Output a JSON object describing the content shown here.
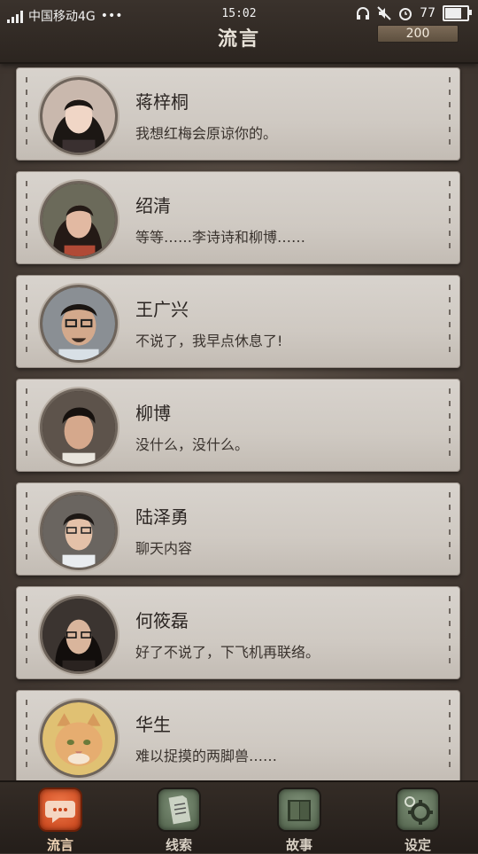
{
  "status_bar": {
    "carrier": "中国移动4G",
    "dots": "•••",
    "time": "15:02",
    "battery_percent": "77",
    "battery_level": 0.77
  },
  "header": {
    "title": "流言",
    "coins": "200"
  },
  "contacts": [
    {
      "name": "蒋梓桐",
      "message": "我想红梅会原谅你的。"
    },
    {
      "name": "绍清",
      "message": "等等……李诗诗和柳博……"
    },
    {
      "name": "王广兴",
      "message": "不说了，我早点休息了!"
    },
    {
      "name": "柳博",
      "message": "没什么，没什么。"
    },
    {
      "name": "陆泽勇",
      "message": "聊天内容"
    },
    {
      "name": "何筱磊",
      "message": "好了不说了，下飞机再联络。"
    },
    {
      "name": "华生",
      "message": "难以捉摸的两脚兽……"
    }
  ],
  "tabs": [
    {
      "label": "流言",
      "icon": "chat-bubble-icon",
      "active": true
    },
    {
      "label": "线索",
      "icon": "document-icon",
      "active": false
    },
    {
      "label": "故事",
      "icon": "book-icon",
      "active": false
    },
    {
      "label": "设定",
      "icon": "gear-icon",
      "active": false
    }
  ],
  "colors": {
    "accent": "#d9582a",
    "card": "#d4cec7",
    "background": "#4a4039"
  }
}
